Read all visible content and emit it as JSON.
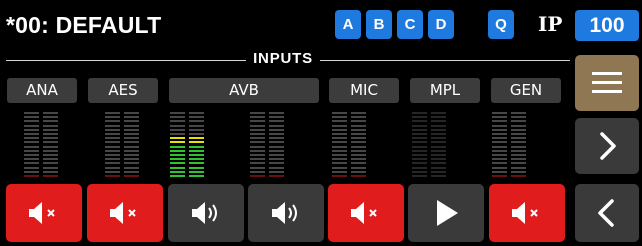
{
  "header": {
    "title": "*00: DEFAULT",
    "presets": [
      "A",
      "B",
      "C",
      "D"
    ],
    "q_label": "Q",
    "ip_label": "IP",
    "ip_value": "100"
  },
  "colors": {
    "accent": "#1f7ae0",
    "mute_red": "#e01c1c",
    "button_grey": "#3a3a3a",
    "menu_tan": "#8e7752",
    "meter_green": "#2ec42e",
    "meter_yellow": "#e8e000"
  },
  "section": {
    "label": "INPUTS"
  },
  "channels": [
    {
      "label": "ANA"
    },
    {
      "label": "AES"
    },
    {
      "label": "AVB"
    },
    {
      "label": "MIC"
    },
    {
      "label": "MPL"
    },
    {
      "label": "GEN"
    }
  ],
  "meters": [
    {
      "id": "ana",
      "level_left": 0,
      "level_right": 0,
      "style": "grey"
    },
    {
      "id": "aes",
      "level_left": 0,
      "level_right": 0,
      "style": "grey"
    },
    {
      "id": "avb-1",
      "level_left": 0.63,
      "level_right": 0.63,
      "style": "active"
    },
    {
      "id": "avb-2",
      "level_left": 0,
      "level_right": 0,
      "style": "grey"
    },
    {
      "id": "mic",
      "level_left": 0,
      "level_right": 0,
      "style": "grey"
    },
    {
      "id": "mpl",
      "level_left": 0,
      "level_right": 0,
      "style": "dim"
    },
    {
      "id": "gen",
      "level_left": 0,
      "level_right": 0,
      "style": "grey"
    }
  ],
  "buttons": [
    {
      "id": "ana",
      "state": "muted",
      "icon": "speaker-muted-icon"
    },
    {
      "id": "aes",
      "state": "muted",
      "icon": "speaker-muted-icon"
    },
    {
      "id": "avb-1",
      "state": "on",
      "icon": "speaker-on-icon"
    },
    {
      "id": "avb-2",
      "state": "on",
      "icon": "speaker-on-icon"
    },
    {
      "id": "mic",
      "state": "muted",
      "icon": "speaker-muted-icon"
    },
    {
      "id": "mpl",
      "state": "play",
      "icon": "play-icon"
    },
    {
      "id": "gen",
      "state": "muted",
      "icon": "speaker-muted-icon"
    }
  ],
  "sidebar": {
    "items": [
      {
        "icon": "hamburger-menu-icon"
      },
      {
        "icon": "chevron-right-icon"
      },
      {
        "icon": "chevron-left-icon"
      }
    ]
  }
}
